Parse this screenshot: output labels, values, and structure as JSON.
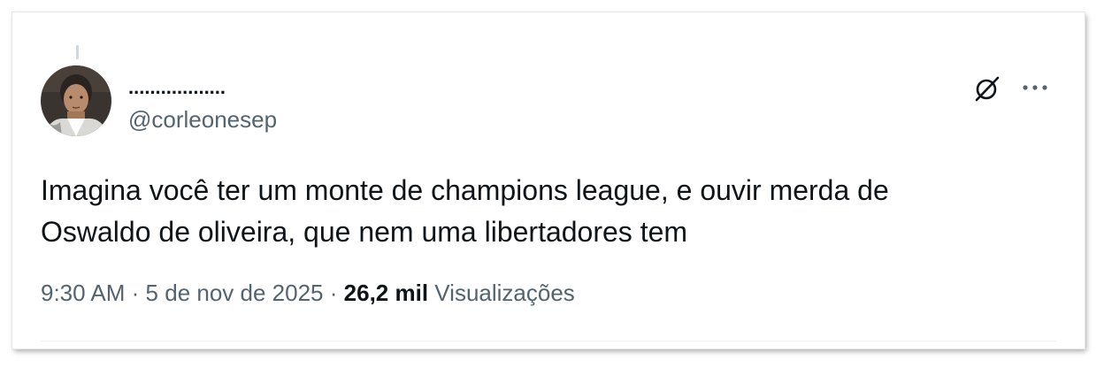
{
  "tweet": {
    "author": {
      "display_name": "..................",
      "handle": "@corleonesep",
      "avatar": "avatar-photo"
    },
    "text_lines": [
      "Imagina você ter um monte de champions league, e ouvir merda de",
      "Oswaldo de oliveira, que nem uma libertadores tem"
    ],
    "time": "9:30 AM",
    "separator": "·",
    "date": "5 de nov de 2025",
    "views_count": "26,2 mil",
    "views_label": "Visualizações",
    "icons": {
      "grok": "grok-icon",
      "more": "more-options-icon"
    }
  },
  "colors": {
    "primary_text": "#0f1419",
    "secondary_text": "#536471",
    "thread_line": "#cfd9de",
    "background": "#ffffff"
  }
}
